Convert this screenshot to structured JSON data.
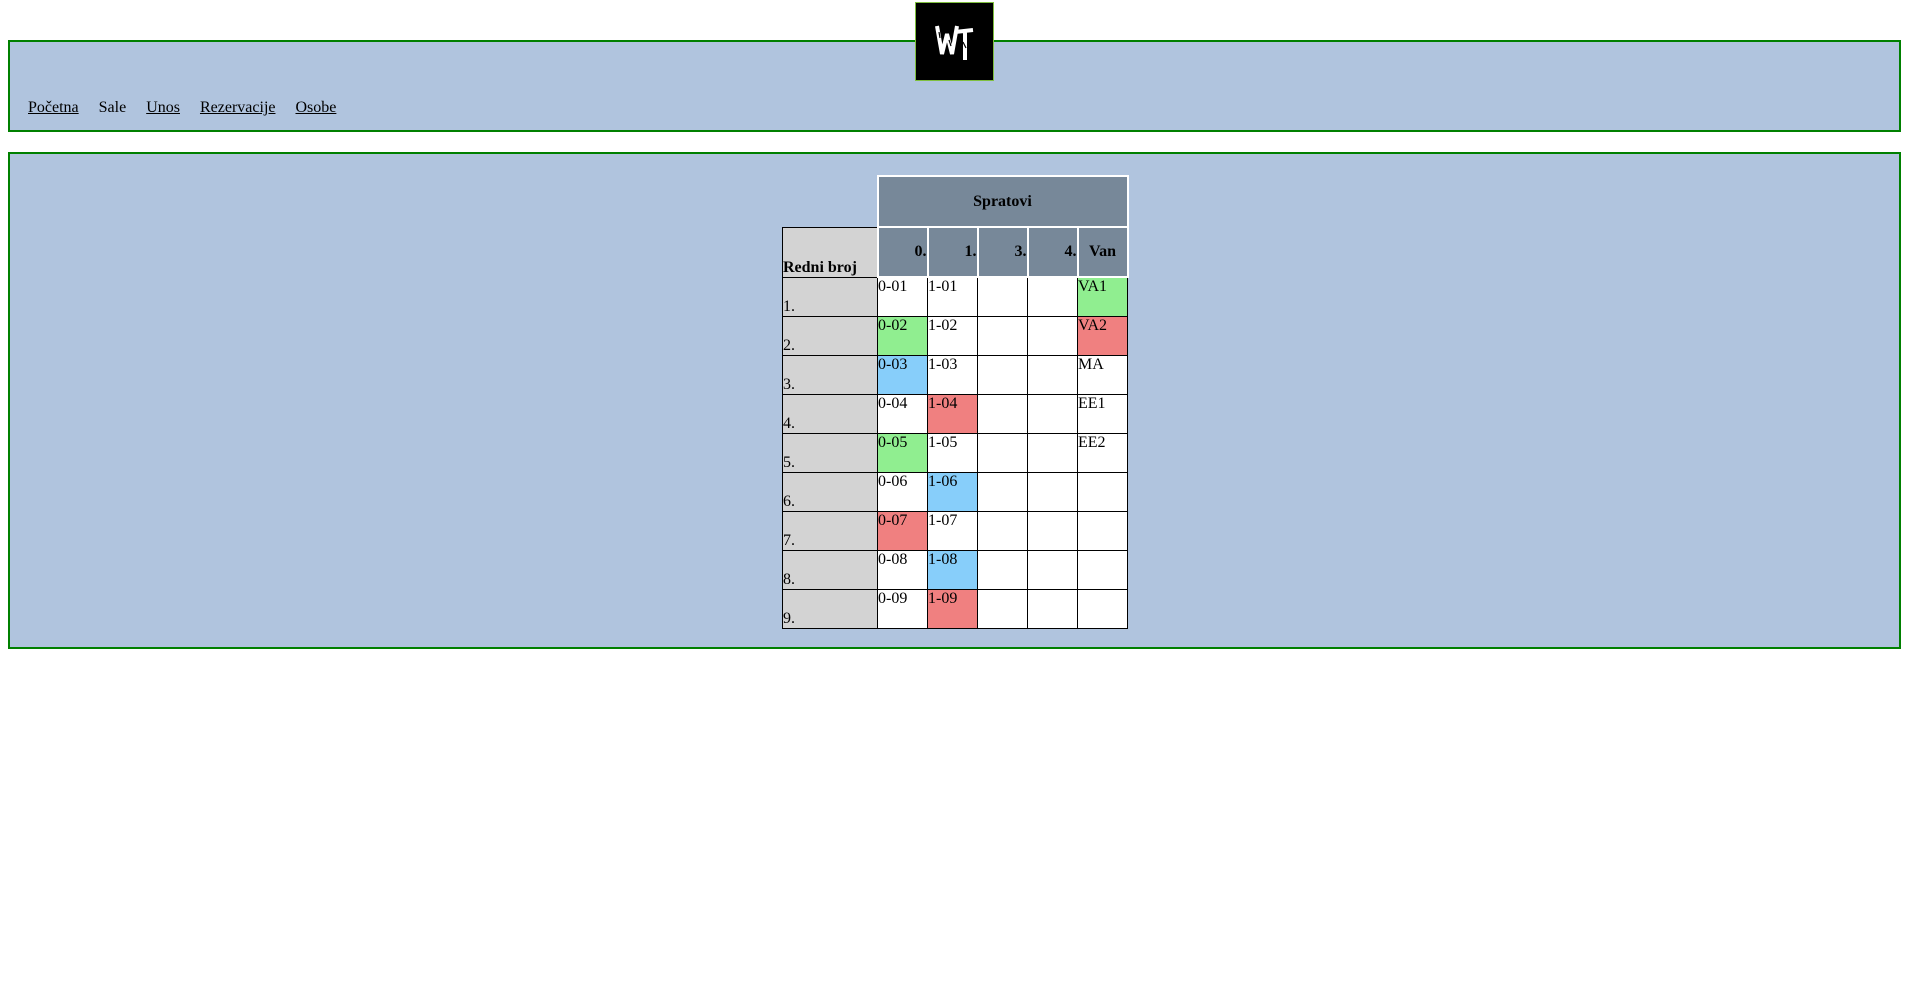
{
  "logo": {
    "alt": "WT",
    "icon": "wt-logo-icon"
  },
  "nav": {
    "items": [
      {
        "label": "Početna",
        "link": true
      },
      {
        "label": "Sale",
        "link": false
      },
      {
        "label": "Unos",
        "link": true
      },
      {
        "label": "Rezervacije",
        "link": true
      },
      {
        "label": "Osobe",
        "link": true
      }
    ]
  },
  "table": {
    "group_header": "Spratovi",
    "row_header": "Redni broj",
    "columns": [
      "0.",
      "1.",
      "3.",
      "4.",
      "Van"
    ],
    "colors": {
      "green": "#90ee90",
      "red": "#f08080",
      "blue": "#87cefa",
      "header": "#778899",
      "rowhead": "#d3d3d3",
      "panel": "#b0c4de",
      "border": "#008000"
    },
    "rows": [
      {
        "num": "1.",
        "cells": [
          {
            "t": "0-01",
            "c": ""
          },
          {
            "t": "1-01",
            "c": ""
          },
          {
            "t": "",
            "c": ""
          },
          {
            "t": "",
            "c": ""
          },
          {
            "t": "VA1",
            "c": "green"
          }
        ]
      },
      {
        "num": "2.",
        "cells": [
          {
            "t": "0-02",
            "c": "green"
          },
          {
            "t": "1-02",
            "c": ""
          },
          {
            "t": "",
            "c": ""
          },
          {
            "t": "",
            "c": ""
          },
          {
            "t": "VA2",
            "c": "red"
          }
        ]
      },
      {
        "num": "3.",
        "cells": [
          {
            "t": "0-03",
            "c": "blue"
          },
          {
            "t": "1-03",
            "c": ""
          },
          {
            "t": "",
            "c": ""
          },
          {
            "t": "",
            "c": ""
          },
          {
            "t": "MA",
            "c": ""
          }
        ]
      },
      {
        "num": "4.",
        "cells": [
          {
            "t": "0-04",
            "c": ""
          },
          {
            "t": "1-04",
            "c": "red"
          },
          {
            "t": "",
            "c": ""
          },
          {
            "t": "",
            "c": ""
          },
          {
            "t": "EE1",
            "c": ""
          }
        ]
      },
      {
        "num": "5.",
        "cells": [
          {
            "t": "0-05",
            "c": "green"
          },
          {
            "t": "1-05",
            "c": ""
          },
          {
            "t": "",
            "c": ""
          },
          {
            "t": "",
            "c": ""
          },
          {
            "t": "EE2",
            "c": ""
          }
        ]
      },
      {
        "num": "6.",
        "cells": [
          {
            "t": "0-06",
            "c": ""
          },
          {
            "t": "1-06",
            "c": "blue"
          },
          {
            "t": "",
            "c": ""
          },
          {
            "t": "",
            "c": ""
          },
          {
            "t": "",
            "c": ""
          }
        ]
      },
      {
        "num": "7.",
        "cells": [
          {
            "t": "0-07",
            "c": "red"
          },
          {
            "t": "1-07",
            "c": ""
          },
          {
            "t": "",
            "c": ""
          },
          {
            "t": "",
            "c": ""
          },
          {
            "t": "",
            "c": ""
          }
        ]
      },
      {
        "num": "8.",
        "cells": [
          {
            "t": "0-08",
            "c": ""
          },
          {
            "t": "1-08",
            "c": "blue"
          },
          {
            "t": "",
            "c": ""
          },
          {
            "t": "",
            "c": ""
          },
          {
            "t": "",
            "c": ""
          }
        ]
      },
      {
        "num": "9.",
        "cells": [
          {
            "t": "0-09",
            "c": ""
          },
          {
            "t": "1-09",
            "c": "red"
          },
          {
            "t": "",
            "c": ""
          },
          {
            "t": "",
            "c": ""
          },
          {
            "t": "",
            "c": ""
          }
        ]
      }
    ]
  }
}
